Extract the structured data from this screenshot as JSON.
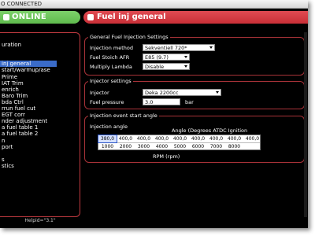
{
  "window": {
    "title": "O CONNECTED"
  },
  "status": {
    "label": "ONLINE",
    "color": "#5fbb4d"
  },
  "page": {
    "title": "Fuel inj general",
    "accent": "#c92f37"
  },
  "nav": {
    "items": [
      {
        "label": ""
      },
      {
        "label": "uration"
      },
      {
        "label": ""
      },
      {
        "label": ""
      },
      {
        "label": "inj general",
        "active": true
      },
      {
        "label": "start/warmup/ase"
      },
      {
        "label": "Prime"
      },
      {
        "label": "IAT Trim"
      },
      {
        "label": "enrich"
      },
      {
        "label": "Baro Trim"
      },
      {
        "label": "bda Ctrl"
      },
      {
        "label": "rrun fuel cut"
      },
      {
        "label": "EGT corr"
      },
      {
        "label": "nder adjustment"
      },
      {
        "label": "a fuel table 1"
      },
      {
        "label": "a fuel table 2"
      },
      {
        "label": "n"
      },
      {
        "label": "port"
      },
      {
        "label": ""
      },
      {
        "label": "s"
      },
      {
        "label": "stics"
      }
    ],
    "helpid": "Helpid=\"3.1\""
  },
  "general": {
    "title": "General Fuel Injection Settings",
    "injection_method_label": "Injection method",
    "injection_method_value": "Sekventiell 720*",
    "stoich_label": "Fuel Stoich AFR",
    "stoich_value": "E85 (9.7)",
    "multiply_label": "Multiply Lambda",
    "multiply_value": "Disable"
  },
  "injector": {
    "title": "Injector settings",
    "injector_label": "Injector",
    "injector_value": "Deka 2200cc",
    "pressure_label": "Fuel pressure",
    "pressure_value": "3.0",
    "pressure_unit": "bar"
  },
  "event": {
    "title": "Injection event start angle",
    "table_label": "Injection angle",
    "header": "Angle (Degrees ATDC Ignition",
    "angles": [
      "380,0",
      "400,0",
      "400,0",
      "400,0",
      "400,0",
      "400,0",
      "400,0",
      "400,0",
      "400,0"
    ],
    "rpms": [
      "1000",
      "2000",
      "3000",
      "4000",
      "5000",
      "6000",
      "7000",
      "8000",
      ""
    ],
    "xlabel": "RPM (rpm)"
  }
}
